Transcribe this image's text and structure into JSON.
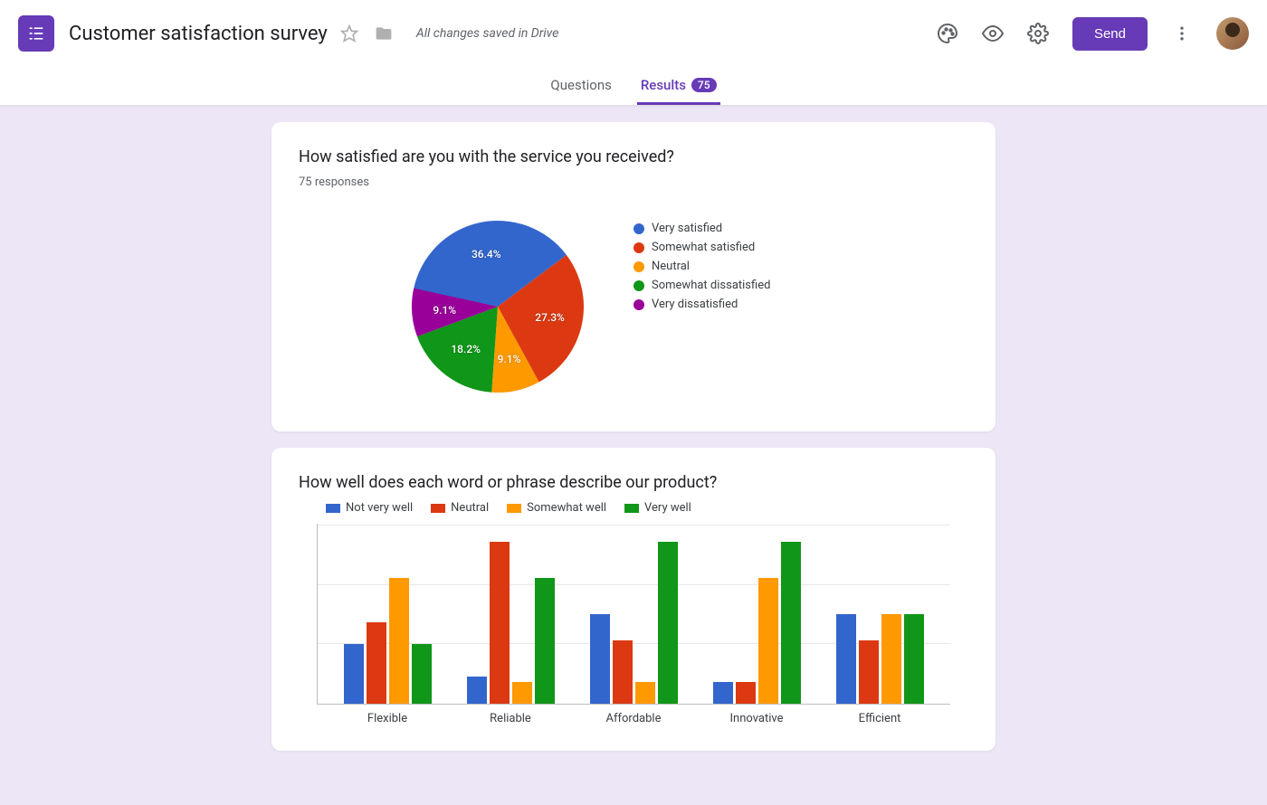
{
  "header": {
    "title": "Customer satisfaction survey",
    "save_status": "All changes saved in Drive",
    "send_label": "Send"
  },
  "tabs": {
    "questions": "Questions",
    "results": "Results",
    "results_count": "75"
  },
  "q1": {
    "title": "How satisfied are you with the service you received?",
    "responses_label": "75 responses"
  },
  "q2": {
    "title": "How well does each word or phrase describe our product?"
  },
  "chart_data": [
    {
      "type": "pie",
      "title": "How satisfied are you with the service you received?",
      "responses": 75,
      "series": [
        {
          "name": "Very satisfied",
          "value": 36.4,
          "label": "36.4%",
          "color": "#3366cc"
        },
        {
          "name": "Somewhat satisfied",
          "value": 27.3,
          "label": "27.3%",
          "color": "#dc3912"
        },
        {
          "name": "Neutral",
          "value": 9.1,
          "label": "9.1%",
          "color": "#ff9900"
        },
        {
          "name": "Somewhat dissatisfied",
          "value": 18.2,
          "label": "18.2%",
          "color": "#109618"
        },
        {
          "name": "Very dissatisfied",
          "value": 9.1,
          "label": "9.1%",
          "color": "#990099"
        }
      ]
    },
    {
      "type": "bar",
      "title": "How well does each word or phrase describe our product?",
      "categories": [
        "Flexible",
        "Reliable",
        "Affordable",
        "Innovative",
        "Efficient"
      ],
      "series": [
        {
          "name": "Not very well",
          "color": "#3366cc",
          "values": [
            33,
            15,
            50,
            12,
            50
          ]
        },
        {
          "name": "Neutral",
          "color": "#dc3912",
          "values": [
            45,
            90,
            35,
            12,
            35
          ]
        },
        {
          "name": "Somewhat well",
          "color": "#ff9900",
          "values": [
            70,
            12,
            12,
            70,
            50
          ]
        },
        {
          "name": "Very well",
          "color": "#109618",
          "values": [
            33,
            70,
            90,
            90,
            50
          ]
        }
      ],
      "ylim": [
        0,
        100
      ]
    }
  ]
}
